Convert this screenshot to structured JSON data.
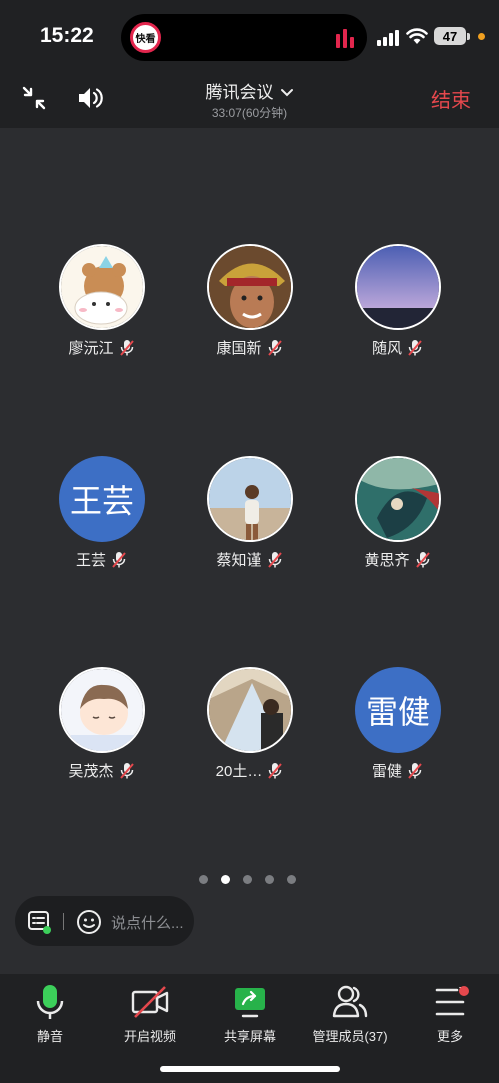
{
  "status": {
    "time": "15:22",
    "battery": "47",
    "island_app": "快看"
  },
  "header": {
    "title": "腾讯会议",
    "subtitle": "33:07(60分钟)",
    "end_label": "结束"
  },
  "participants": [
    {
      "name": "廖沅江",
      "avatar": "cartoon-bear"
    },
    {
      "name": "康国新",
      "avatar": "warrior"
    },
    {
      "name": "随风",
      "avatar": "sky"
    },
    {
      "name": "王芸",
      "avatar_text": "王芸"
    },
    {
      "name": "蔡知谨",
      "avatar": "person-beach"
    },
    {
      "name": "黄思齐",
      "avatar": "fantasy-art"
    },
    {
      "name": "吴茂杰",
      "avatar": "anime-boy"
    },
    {
      "name": "20土…",
      "avatar": "tent-photo"
    },
    {
      "name": "雷健",
      "avatar_text": "雷健"
    }
  ],
  "pagination": {
    "pages": 5,
    "current": 2
  },
  "chat": {
    "placeholder": "说点什么..."
  },
  "toolbar": {
    "mute": "静音",
    "video": "开启视频",
    "share": "共享屏幕",
    "members": "管理成员(37)",
    "more": "更多"
  },
  "colors": {
    "end_red": "#e5484d",
    "mic_green": "#3ccf5a",
    "share_green": "#27b24a",
    "avatar_blue": "#3d6fc5"
  }
}
